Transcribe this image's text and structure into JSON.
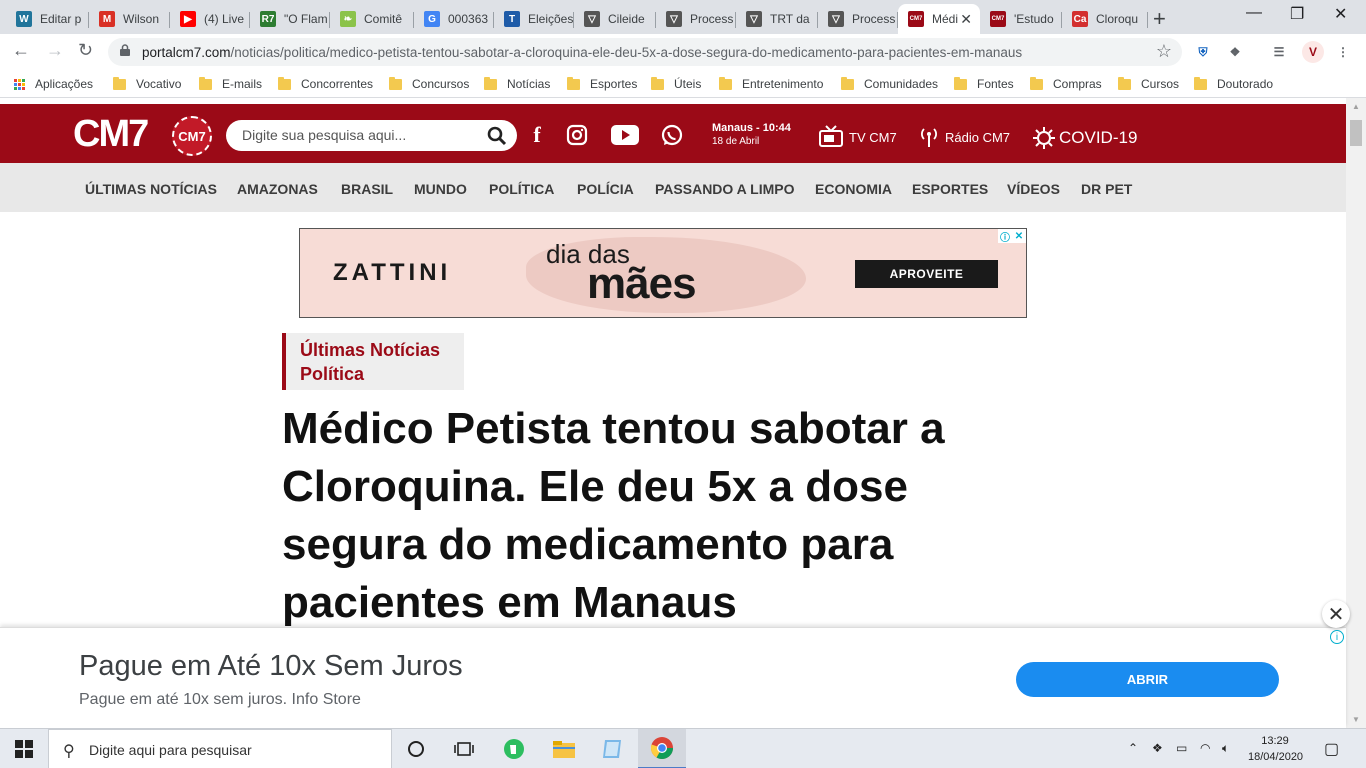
{
  "tabs": [
    {
      "title": "Editar p",
      "icon": "wordpress-icon",
      "color": "#21759b",
      "glyph": "W"
    },
    {
      "title": "Wilson",
      "icon": "gmail-icon",
      "color": "#d93025",
      "glyph": "M"
    },
    {
      "title": "(4) Live",
      "icon": "youtube-icon",
      "color": "#ff0000",
      "glyph": "▶"
    },
    {
      "title": "\"O Flam",
      "icon": "r7-icon",
      "color": "#2e7d32",
      "glyph": "R7"
    },
    {
      "title": "Comitê",
      "icon": "leaf-icon",
      "color": "#8bc34a",
      "glyph": "❧"
    },
    {
      "title": "000363",
      "icon": "google-icon",
      "color": "#4285f4",
      "glyph": "G"
    },
    {
      "title": "Eleições",
      "icon": "eleicoes-icon",
      "color": "#1e5ba8",
      "glyph": "T"
    },
    {
      "title": "Cileide",
      "icon": "vuejs-icon",
      "color": "#555555",
      "glyph": "▽"
    },
    {
      "title": "Process",
      "icon": "vuejs-icon",
      "color": "#555555",
      "glyph": "▽"
    },
    {
      "title": "TRT da",
      "icon": "vuejs-icon",
      "color": "#555555",
      "glyph": "▽"
    },
    {
      "title": "Process",
      "icon": "vuejs-icon",
      "color": "#555555",
      "glyph": "▽"
    },
    {
      "title": "Médi",
      "icon": "cm7-icon",
      "color": "#9b0a17",
      "glyph": "CM7",
      "active": true
    },
    {
      "title": "'Estudo",
      "icon": "cm7-icon",
      "color": "#9b0a17",
      "glyph": "CM7"
    },
    {
      "title": "Cloroqu",
      "icon": "carta-icon",
      "color": "#d32f2f",
      "glyph": "Ca"
    }
  ],
  "toolbar": {
    "url_host": "portalcm7.com",
    "url_path": "/noticias/politica/medico-petista-tentou-sabotar-a-cloroquina-ele-deu-5x-a-dose-segura-do-medicamento-para-pacientes-em-manaus"
  },
  "bookmarks": [
    "Aplicações",
    "Vocativo",
    "E-mails",
    "Concorrentes",
    "Concursos",
    "Notícias",
    "Esportes",
    "Úteis",
    "Entretenimento",
    "Comunidades",
    "Fontes",
    "Compras",
    "Cursos",
    "Doutorado"
  ],
  "site": {
    "logo": "CM7",
    "logo_badge": "CM7",
    "search_placeholder": "Digite sua pesquisa aqui...",
    "location_time": "Manaus - 10:44",
    "date": "18 de Abril",
    "tv": "TV CM7",
    "radio": "Rádio CM7",
    "covid": "COVID-19",
    "brand_color": "#9b0a17"
  },
  "categories": [
    "ÚLTIMAS NOTÍCIAS",
    "AMAZONAS",
    "BRASIL",
    "MUNDO",
    "POLÍTICA",
    "POLÍCIA",
    "PASSANDO A LIMPO",
    "ECONOMIA",
    "ESPORTES",
    "VÍDEOS",
    "DR PET"
  ],
  "ad_banner": {
    "brand": "ZATTINI",
    "line1": "dia das",
    "line2": "mães",
    "cta": "APROVEITE"
  },
  "article": {
    "breadcrumb": [
      "Últimas Notícias",
      "Política"
    ],
    "headline": "Médico Petista tentou sabotar a Cloroquina. Ele deu 5x a dose segura do medicamento para pacientes em Manaus"
  },
  "bottom_ad": {
    "title": "Pague em Até 10x Sem Juros",
    "subtitle": "Pague em até 10x sem juros. Info Store",
    "cta": "ABRIR"
  },
  "taskbar": {
    "search_placeholder": "Digite aqui para pesquisar",
    "time": "13:29",
    "date": "18/04/2020"
  }
}
